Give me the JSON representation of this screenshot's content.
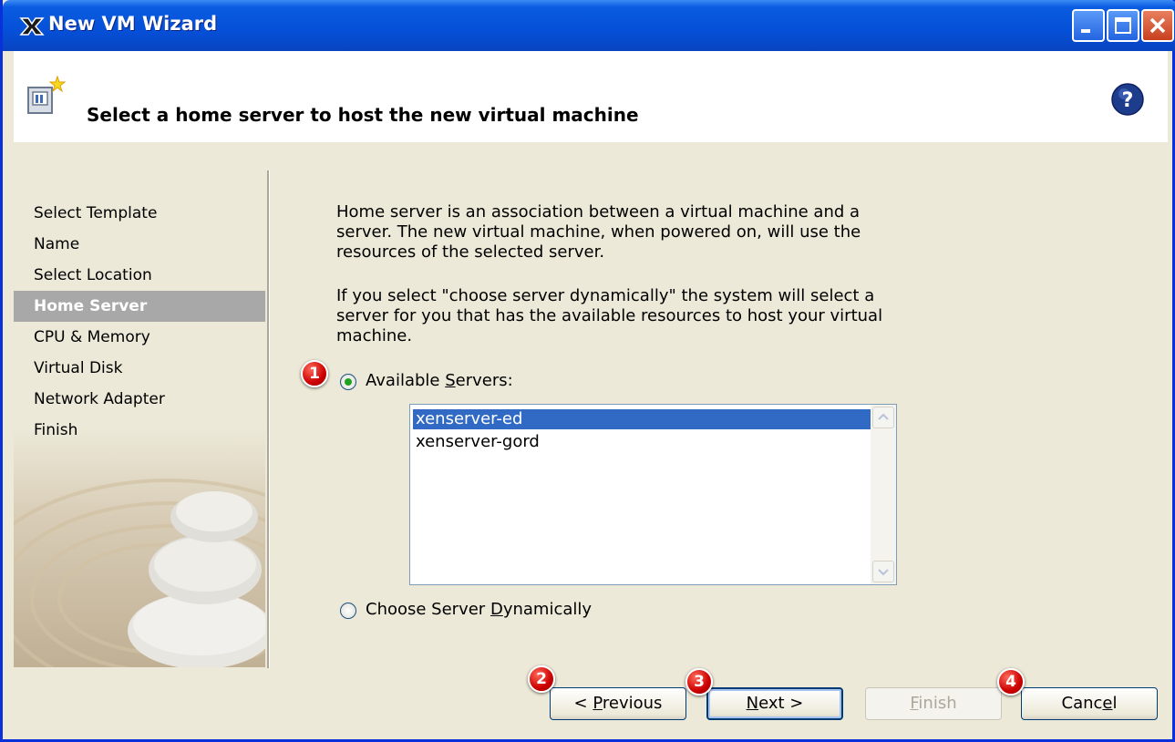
{
  "window": {
    "title": "New VM Wizard"
  },
  "header": {
    "title": "Select a home server to host the new virtual machine"
  },
  "nav": {
    "items": [
      {
        "label": "Select Template"
      },
      {
        "label": "Name"
      },
      {
        "label": "Select Location"
      },
      {
        "label": "Home Server",
        "selected": true
      },
      {
        "label": "CPU & Memory"
      },
      {
        "label": "Virtual Disk"
      },
      {
        "label": "Network Adapter"
      },
      {
        "label": "Finish"
      }
    ]
  },
  "content": {
    "paragraph1_lines": [
      "Home server is an association between a virtual machine and a",
      "server. The new virtual machine, when powered on, will use the",
      "resources of the selected server."
    ],
    "paragraph2_lines": [
      "If you select \"choose server dynamically\" the system will select a",
      "server for you that has the available resources to host your virtual",
      "machine."
    ],
    "option_available": {
      "label_pre": "Available ",
      "label_accel": "S",
      "label_post": "ervers:",
      "checked": true
    },
    "servers": [
      {
        "name": "xenserver-ed",
        "selected": true
      },
      {
        "name": "xenserver-gord",
        "selected": false
      }
    ],
    "option_dynamic": {
      "label_pre": "Choose Server ",
      "label_accel": "D",
      "label_post": "ynamically",
      "checked": false
    }
  },
  "buttons": {
    "previous": {
      "pre": "< ",
      "accel": "P",
      "post": "revious"
    },
    "next": {
      "pre": "",
      "accel": "N",
      "post": "ext >"
    },
    "finish": {
      "pre": "",
      "accel": "F",
      "post": "inish",
      "enabled": false
    },
    "cancel": {
      "pre": "Canc",
      "accel": "e",
      "post": "l"
    }
  },
  "badges": [
    "1",
    "2",
    "3",
    "4"
  ],
  "colors": {
    "titlebar": "#0a5ce0",
    "selection": "#316ac5",
    "nav_selected": "#a8a8a8",
    "badge": "#cc0000",
    "radio_dot": "#21a121"
  }
}
